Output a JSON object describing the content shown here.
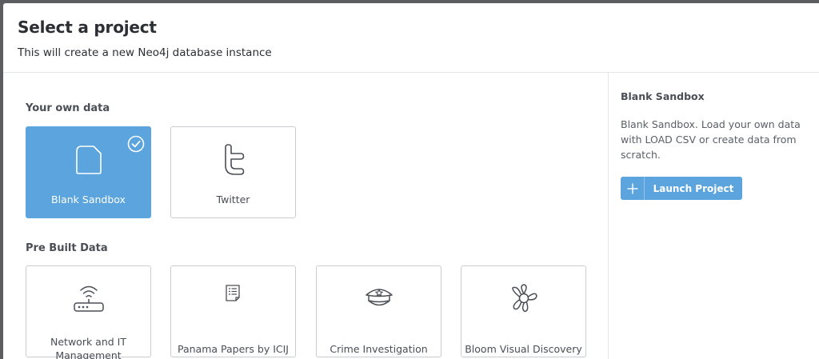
{
  "header": {
    "title": "Select a project",
    "subtitle": "This will create a new Neo4j database instance"
  },
  "sections": {
    "own_data": {
      "title": "Your own data",
      "cards": [
        {
          "label": "Blank Sandbox",
          "icon": "blank-document-icon",
          "selected": true
        },
        {
          "label": "Twitter",
          "icon": "twitter-icon",
          "selected": false
        }
      ]
    },
    "prebuilt": {
      "title": "Pre Built Data",
      "cards": [
        {
          "label": "Network and IT Management",
          "icon": "router-icon"
        },
        {
          "label": "Panama Papers by ICIJ",
          "icon": "document-list-icon"
        },
        {
          "label": "Crime Investigation",
          "icon": "police-cap-icon"
        },
        {
          "label": "Bloom Visual Discovery",
          "icon": "flower-icon"
        }
      ]
    }
  },
  "details": {
    "title": "Blank Sandbox",
    "description": "Blank Sandbox. Load your own data with LOAD CSV or create data from scratch.",
    "launch_label": "Launch Project"
  },
  "colors": {
    "accent": "#5ba4dd",
    "backdrop": "#5b5d60",
    "card_border": "#c9cdd2",
    "text_dark": "#2b2e33",
    "text_muted": "#4a4e55"
  }
}
